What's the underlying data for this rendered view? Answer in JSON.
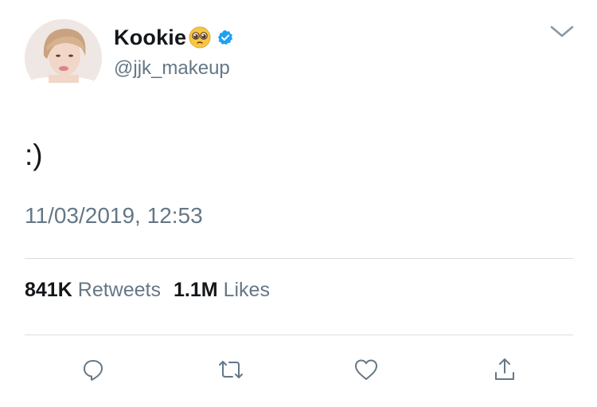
{
  "tweet": {
    "display_name": "Kookie",
    "handle": "@jjk_makeup",
    "text": ":)",
    "timestamp": "11/03/2019, 12:53",
    "verified": true,
    "name_emoji": "pleading-face-icon"
  },
  "stats": {
    "retweets_count": "841K",
    "retweets_label": "Retweets",
    "likes_count": "1.1M",
    "likes_label": "Likes"
  },
  "actions": [
    "reply-icon",
    "retweet-icon",
    "like-icon",
    "share-icon"
  ],
  "colors": {
    "text_primary": "#14171a",
    "text_secondary": "#657786",
    "verified_blue": "#1da1f2",
    "divider": "#d9dde1",
    "icon_gray": "#657786"
  }
}
